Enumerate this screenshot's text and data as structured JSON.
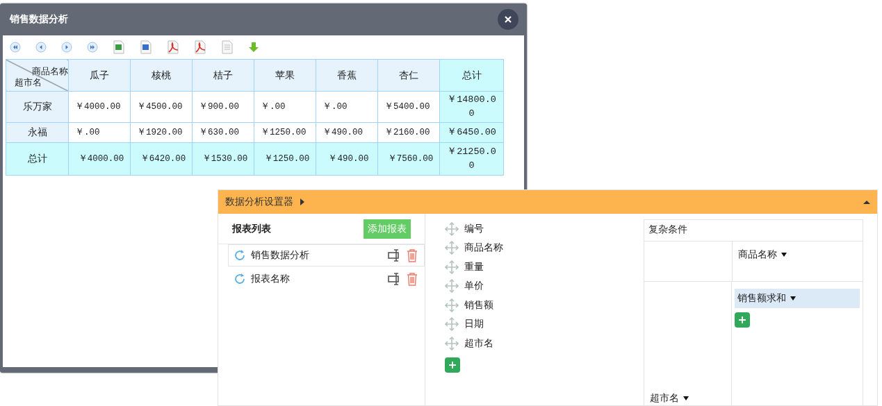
{
  "dialog": {
    "title": "销售数据分析"
  },
  "table": {
    "corner_top": "商品名称",
    "corner_bottom": "超市名",
    "columns": [
      {
        "label": "瓜子",
        "kind": "item"
      },
      {
        "label": "核桃",
        "kind": "item"
      },
      {
        "label": "桔子",
        "kind": "item"
      },
      {
        "label": "苹果",
        "kind": "item"
      },
      {
        "label": "香蕉",
        "kind": "item"
      },
      {
        "label": "杏仁",
        "kind": "item"
      },
      {
        "label": "总计",
        "kind": "total"
      }
    ],
    "rows": [
      {
        "name": "乐万家",
        "kind": "data",
        "cells": [
          "￥4000.00",
          "￥4500.00",
          "￥900.00",
          "￥.00",
          "￥.00",
          "￥5400.00",
          "￥14800.00"
        ]
      },
      {
        "name": "永福",
        "kind": "data",
        "cells": [
          "￥.00",
          "￥1920.00",
          "￥630.00",
          "￥1250.00",
          "￥490.00",
          "￥2160.00",
          "￥6450.00"
        ]
      },
      {
        "name": "总计",
        "kind": "total",
        "cells": [
          "￥4000.00",
          "￥6420.00",
          "￥1530.00",
          "￥1250.00",
          "￥490.00",
          "￥7560.00",
          "￥21250.00"
        ]
      }
    ]
  },
  "panel": {
    "title": "数据分析设置器",
    "report_list": {
      "title": "报表列表",
      "add_button": "添加报表",
      "items": [
        {
          "name": "销售数据分析",
          "selected": true
        },
        {
          "name": "报表名称",
          "selected": false
        }
      ]
    },
    "fields": [
      "编号",
      "商品名称",
      "重量",
      "单价",
      "销售额",
      "日期",
      "超市名"
    ],
    "conditions": {
      "title": "复杂条件",
      "column_field": "商品名称",
      "value_field": "销售额求和",
      "row_field": "超市名"
    }
  }
}
